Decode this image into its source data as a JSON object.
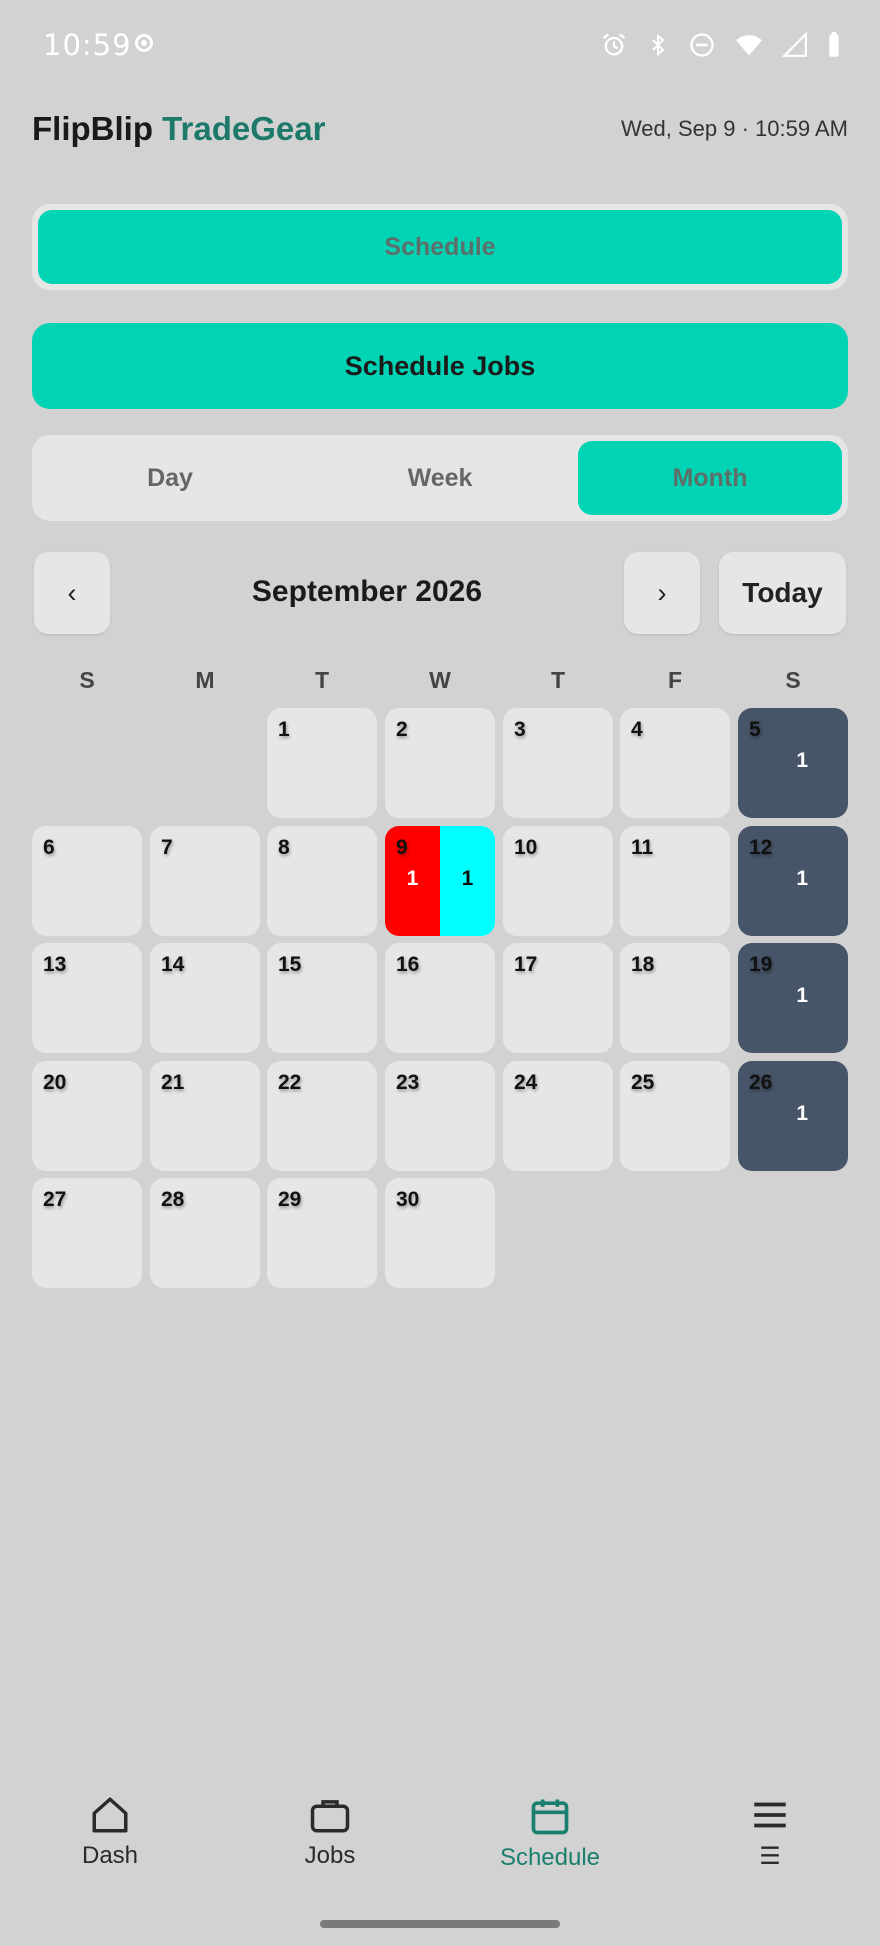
{
  "status_bar": {
    "time": "10:59",
    "icons": [
      "alarm-icon",
      "bluetooth-icon",
      "do-not-disturb-icon",
      "wifi-icon",
      "signal-icon",
      "battery-icon"
    ]
  },
  "header": {
    "brand_part1": "FlipBlip",
    "brand_part2": "TradeGear",
    "date_time": "Wed, Sep 9 · 10:59 AM"
  },
  "schedule_select": {
    "value": "Schedule"
  },
  "schedule_jobs_label": "Schedule Jobs",
  "view_tabs": [
    {
      "label": "Day",
      "active": false
    },
    {
      "label": "Week",
      "active": false
    },
    {
      "label": "Month",
      "active": true
    }
  ],
  "calendar": {
    "prev_label": "‹",
    "next_label": "›",
    "today_label": "Today",
    "month_title": "September 2026",
    "weekdays": [
      "S",
      "M",
      "T",
      "W",
      "T",
      "F",
      "S"
    ],
    "colors": {
      "busy": "#475569",
      "job_red": "#ff0000",
      "job_cyan": "#00ffff",
      "accent": "#00d4b4"
    },
    "weeks": [
      [
        null,
        null,
        {
          "day": "1"
        },
        {
          "day": "2"
        },
        {
          "day": "3"
        },
        {
          "day": "4"
        },
        {
          "day": "5",
          "count": "1",
          "busy": true
        }
      ],
      [
        {
          "day": "6"
        },
        {
          "day": "7"
        },
        {
          "day": "8"
        },
        {
          "day": "9",
          "split": [
            "1",
            "1"
          ]
        },
        {
          "day": "10"
        },
        {
          "day": "11"
        },
        {
          "day": "12",
          "count": "1",
          "busy": true
        }
      ],
      [
        {
          "day": "13"
        },
        {
          "day": "14"
        },
        {
          "day": "15"
        },
        {
          "day": "16"
        },
        {
          "day": "17"
        },
        {
          "day": "18"
        },
        {
          "day": "19",
          "count": "1",
          "busy": true
        }
      ],
      [
        {
          "day": "20"
        },
        {
          "day": "21"
        },
        {
          "day": "22"
        },
        {
          "day": "23"
        },
        {
          "day": "24"
        },
        {
          "day": "25"
        },
        {
          "day": "26",
          "count": "1",
          "busy": true
        }
      ],
      [
        {
          "day": "27"
        },
        {
          "day": "28"
        },
        {
          "day": "29"
        },
        {
          "day": "30"
        },
        null,
        null,
        null
      ]
    ]
  },
  "bottom_nav": [
    {
      "label": "Dash",
      "icon": "home-icon",
      "active": false
    },
    {
      "label": "Jobs",
      "icon": "briefcase-icon",
      "active": false
    },
    {
      "label": "Schedule",
      "icon": "calendar-icon",
      "active": true
    },
    {
      "label": "☰",
      "icon": "menu-icon",
      "active": false
    }
  ]
}
